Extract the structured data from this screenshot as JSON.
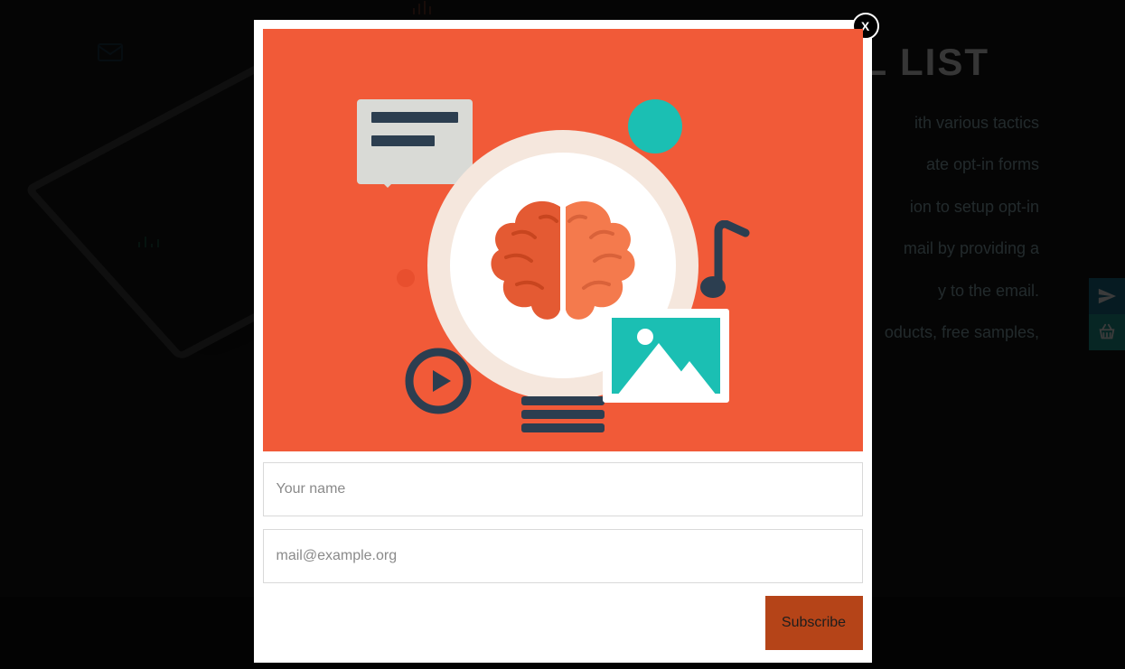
{
  "background": {
    "title": "AIL LIST",
    "lines": [
      "ith various tactics",
      "ate opt-in forms",
      "ion to setup opt-in",
      "mail by providing a",
      "y to the email.",
      "oducts, free samples,"
    ]
  },
  "modal": {
    "close_label": "X",
    "name_placeholder": "Your name",
    "email_placeholder": "mail@example.org",
    "submit_label": "Subscribe"
  },
  "side": {
    "send_title": "Send",
    "cart_title": "Cart"
  },
  "colors": {
    "hero_bg": "#f15a38",
    "accent_teal": "#1bbfb3",
    "submit_bg": "#b54418"
  }
}
